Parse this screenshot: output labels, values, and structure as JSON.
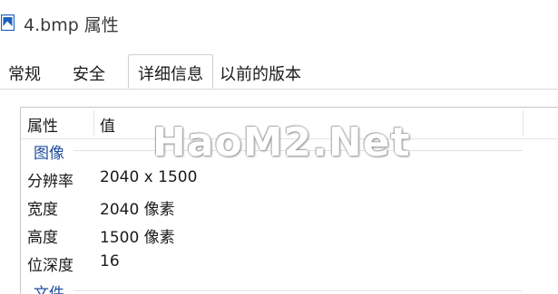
{
  "window": {
    "title": "4.bmp 属性"
  },
  "tabs": [
    {
      "label": "常规"
    },
    {
      "label": "安全"
    },
    {
      "label": "详细信息"
    },
    {
      "label": "以前的版本"
    }
  ],
  "active_tab": "详细信息",
  "details": {
    "columns": {
      "name": "属性",
      "value": "值"
    },
    "groups": [
      {
        "label": "图像"
      },
      {
        "label": "文件"
      }
    ],
    "rows": [
      {
        "key": "分辨率",
        "value": "2040 x 1500"
      },
      {
        "key": "宽度",
        "value": "2040 像素"
      },
      {
        "key": "高度",
        "value": "1500 像素"
      },
      {
        "key": "位深度",
        "value": "16"
      }
    ]
  },
  "watermark": "HaoM2.Net",
  "colors": {
    "group_label": "#1f4e9c",
    "icon": "#1c5fbf"
  }
}
